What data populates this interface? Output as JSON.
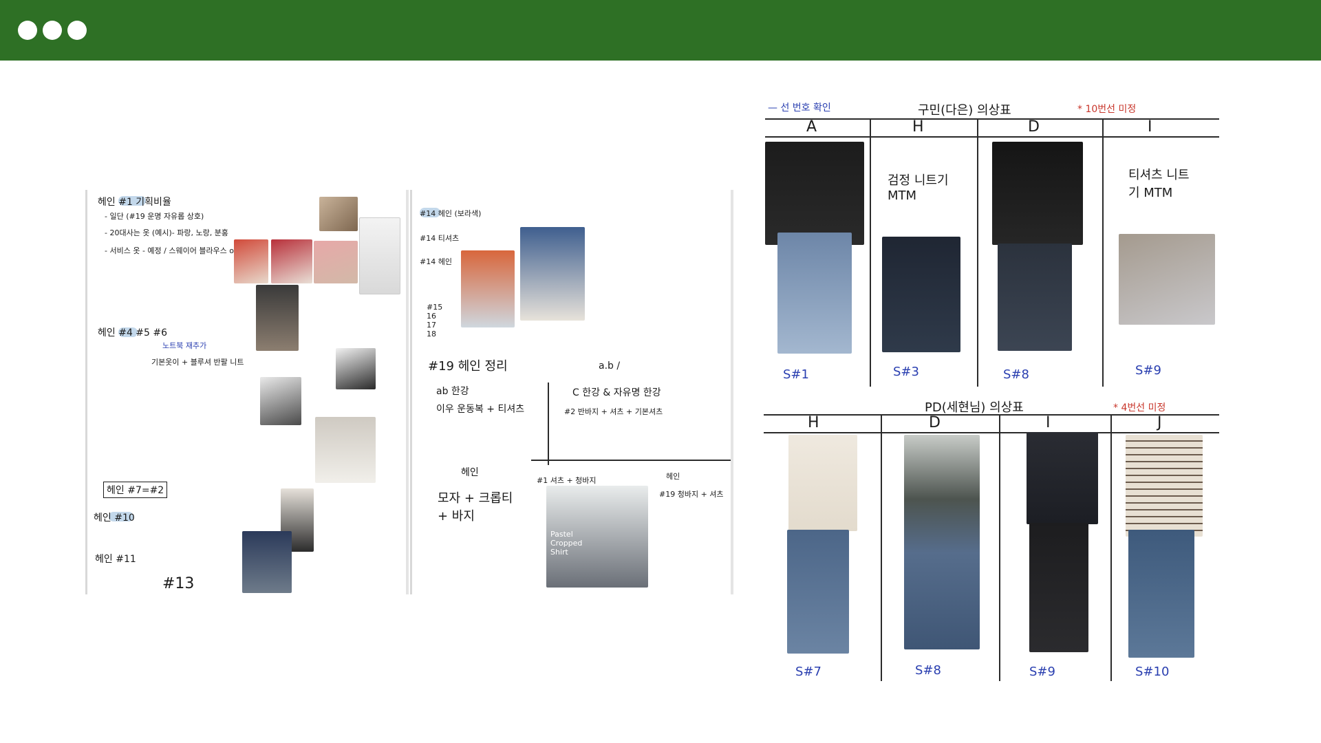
{
  "colors": {
    "header_bar": "#2e7025",
    "ink": "#1a1a1a",
    "blue_ink": "#2a3fb0",
    "red_ink": "#c8362b",
    "green_ink": "#2e9a6e",
    "highlight": "#a9c7e3"
  },
  "window_controls": [
    "dot",
    "dot",
    "dot"
  ],
  "notes_left": {
    "lines": [
      "헤인 #1 기획비율",
      "- 일단 (#19 운명 자유롭 상호)",
      "- 20대사는 옷 (예시)- 파랑, 노랑, 분홍",
      "- 서비스 옷 - 예정 / 스웨이어 블라우스 or 셔츠",
      "헤인 #4 #5 #6",
      "노트북 재추가",
      "기본옷이 + 블루셔 반팔 니트",
      "헤인 #7=#2",
      "헤인 #10",
      "헤인 #11",
      "#13"
    ]
  },
  "notes_middle": {
    "lines": [
      "#14 헤인 (보라색)",
      "#14 티셔츠",
      "#14 헤인",
      "#15 16 17 18",
      "#19 헤인 정리",
      "a.b /",
      "ab 한강",
      "이우 운동복 + 티셔츠",
      "C 한강 & 자유명 한강",
      "#2 반바지 + 셔츠 + 기본셔츠",
      "헤인",
      "모자 + 크롭티 + 바지",
      "#1 셔츠 + 청바지",
      "헤인",
      "#19 청바지 + 셔츠",
      "Pastel Cropped Shirt"
    ]
  },
  "costume_sheet_top": {
    "legend": "— 선 번호 확인",
    "title": "구민(다은) 의상표",
    "note": "* 10번선 미정",
    "columns": [
      "A",
      "H",
      "D",
      "I"
    ],
    "cells": [
      "검정 니트기 MTM",
      "티셔츠 니트기 MTM"
    ],
    "scene_labels": [
      "S#1",
      "S#3",
      "S#8",
      "S#9"
    ]
  },
  "costume_sheet_bottom": {
    "title": "PD(세현님) 의상표",
    "note": "* 4번선 미정",
    "columns": [
      "H",
      "D",
      "I",
      "J"
    ],
    "scene_labels": [
      "S#7",
      "S#8",
      "S#9",
      "S#10"
    ]
  }
}
